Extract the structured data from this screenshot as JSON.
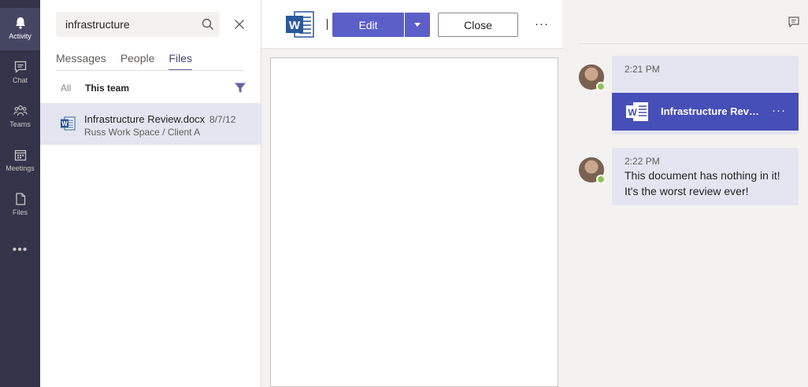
{
  "rail": {
    "items": [
      {
        "label": "Activity",
        "icon": "bell-icon"
      },
      {
        "label": "Chat",
        "icon": "chat-icon"
      },
      {
        "label": "Teams",
        "icon": "teams-icon"
      },
      {
        "label": "Meetings",
        "icon": "calendar-icon"
      },
      {
        "label": "Files",
        "icon": "file-icon"
      }
    ],
    "more": "•••",
    "active_color": "#454662",
    "background": "#33344a"
  },
  "search": {
    "query": "infrastructure",
    "tabs": [
      {
        "label": "Messages"
      },
      {
        "label": "People"
      },
      {
        "label": "Files"
      }
    ],
    "filter": {
      "all": "All",
      "team": "This team"
    },
    "results": [
      {
        "name": "Infrastructure Review.docx",
        "date": "8/7/12",
        "path": "Russ Work Space / Client A"
      }
    ]
  },
  "document": {
    "app_logo": "word-icon",
    "edit_label": "Edit",
    "close_label": "Close",
    "more_label": "···",
    "accent": "#5b5fc7"
  },
  "conversation": {
    "messages": [
      {
        "time": "2:21 PM",
        "file_name": "Infrastructure Review.docx",
        "more": "···"
      },
      {
        "time": "2:22 PM",
        "lines": [
          "This document has nothing in it!",
          "It's the worst review ever!"
        ]
      }
    ],
    "presence_color": "#92c353"
  }
}
